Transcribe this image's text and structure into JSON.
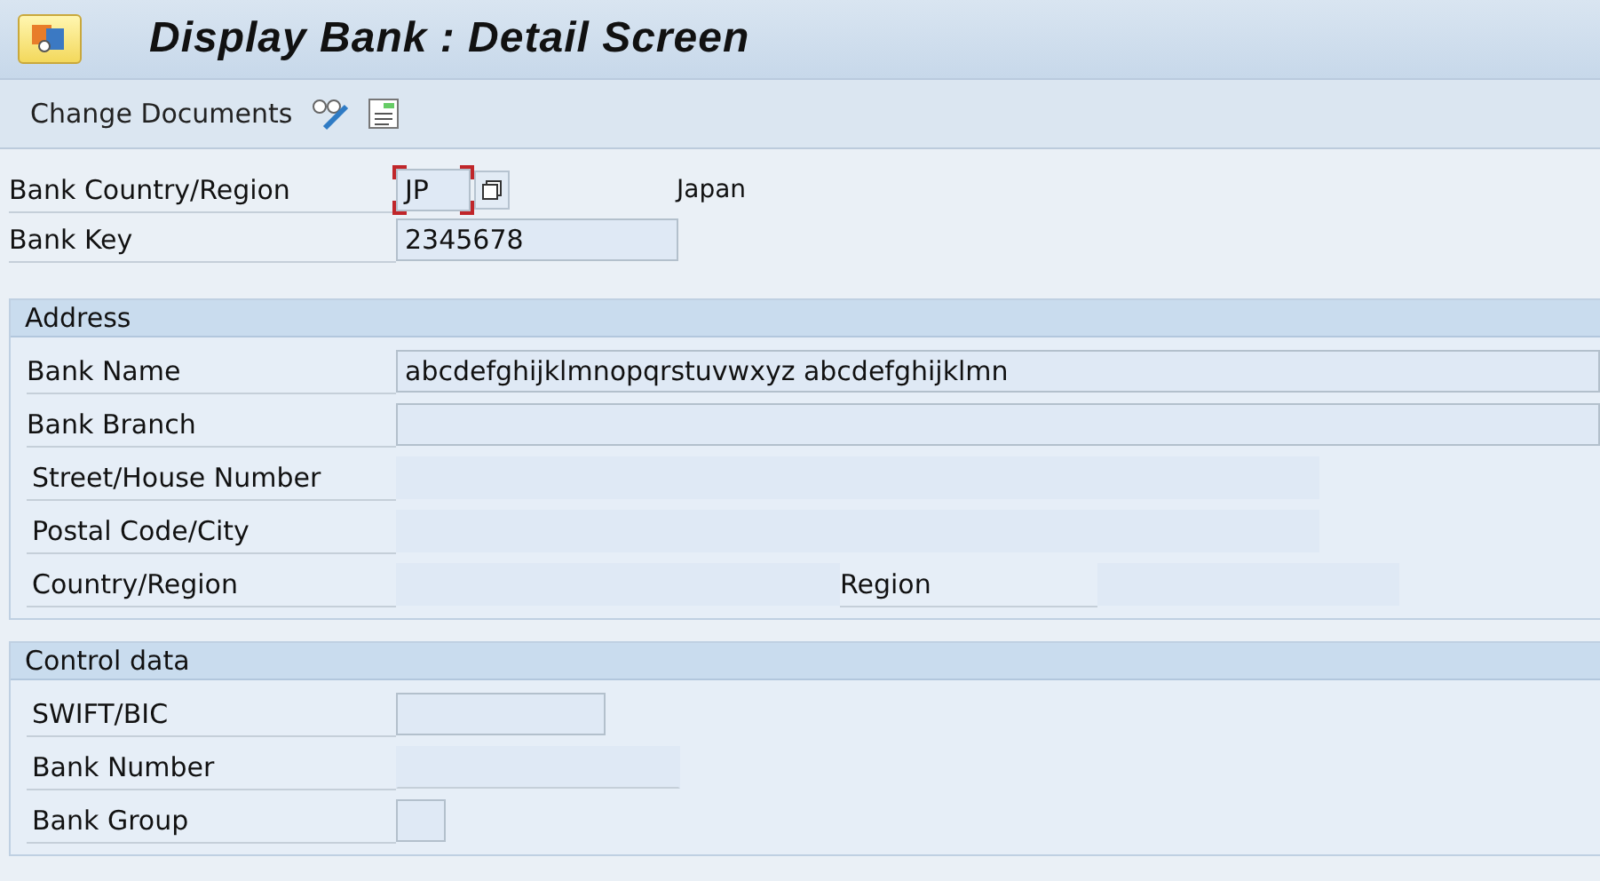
{
  "window": {
    "title": "Display Bank : Detail Screen"
  },
  "toolbar": {
    "items": [
      {
        "kind": "text",
        "label": "Change Documents"
      },
      {
        "kind": "glasses"
      },
      {
        "kind": "document"
      }
    ]
  },
  "key_fields": [
    {
      "label": "Bank Country/Region",
      "value": "JP",
      "focused": true,
      "value_help": true,
      "description": "Japan"
    },
    {
      "label": "Bank Key",
      "value": "2345678",
      "focused": false,
      "value_help": false
    }
  ],
  "groups": [
    {
      "title": "Address",
      "rows": [
        {
          "kind": "wide",
          "label": "Bank Name",
          "value": "abcdefghijklmnopqrstuvwxyz abcdefghijklmn"
        },
        {
          "kind": "wide",
          "label": "Bank Branch"
        },
        {
          "kind": "flat",
          "label": "Street/House Number"
        },
        {
          "kind": "flat",
          "label": "Postal Code/City"
        },
        {
          "kind": "pair",
          "label": "Country/Region",
          "second_label": "Region"
        }
      ]
    },
    {
      "title": "Control data",
      "rows": [
        {
          "kind": "medium",
          "label": "SWIFT/BIC"
        },
        {
          "kind": "flatshort",
          "label": "Bank Number"
        },
        {
          "kind": "tiny",
          "label": "Bank Group"
        }
      ]
    }
  ]
}
